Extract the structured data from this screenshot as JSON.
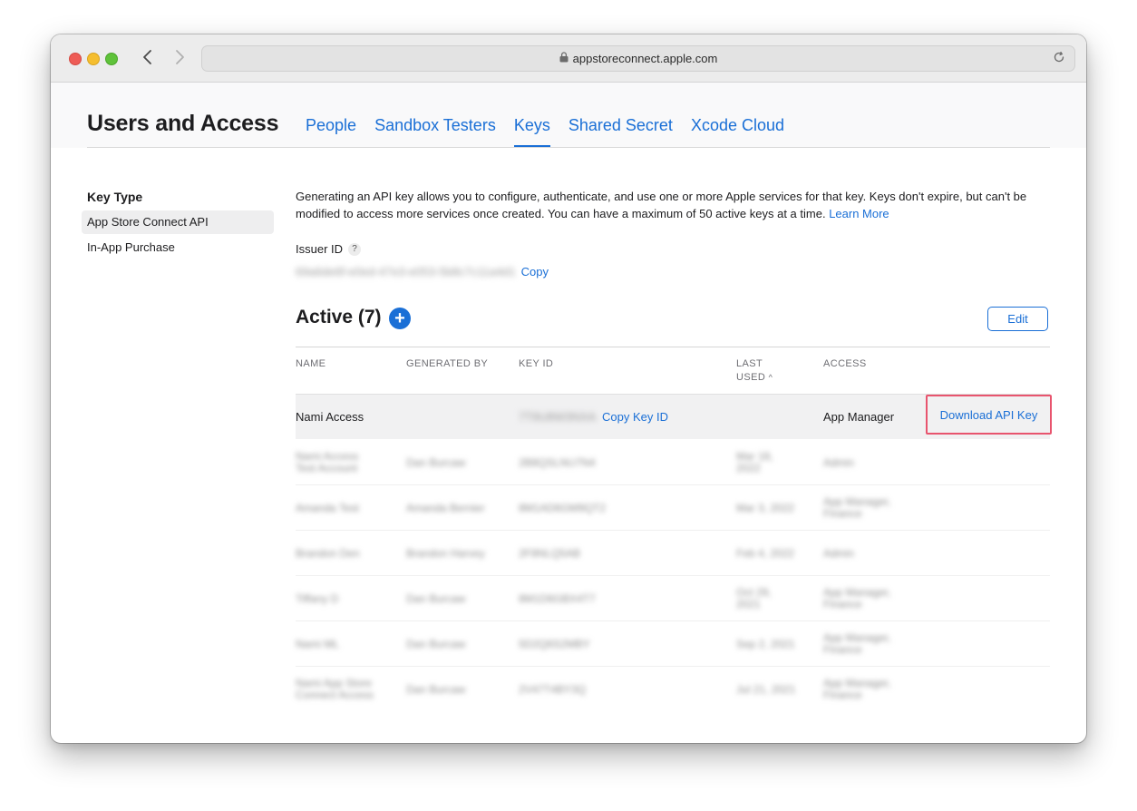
{
  "browser": {
    "url": "appstoreconnect.apple.com"
  },
  "header": {
    "title": "Users and Access",
    "tabs": [
      {
        "label": "People",
        "active": false
      },
      {
        "label": "Sandbox Testers",
        "active": false
      },
      {
        "label": "Keys",
        "active": true
      },
      {
        "label": "Shared Secret",
        "active": false
      },
      {
        "label": "Xcode Cloud",
        "active": false
      }
    ]
  },
  "sidebar": {
    "heading": "Key Type",
    "items": [
      {
        "label": "App Store Connect API",
        "selected": true
      },
      {
        "label": "In-App Purchase",
        "selected": false
      }
    ]
  },
  "main": {
    "description": "Generating an API key allows you to configure, authenticate, and use one or more Apple services for that key. Keys don't expire, but can't be modified to access more services once created. You can have a maximum of 50 active keys at a time.",
    "learn_more": "Learn More",
    "issuer_label": "Issuer ID",
    "issuer_help": "?",
    "issuer_value": "69a6de6f-e0ed-47e3-e053-5b8c7c11a4d1",
    "issuer_copy": "Copy",
    "active_title": "Active (7)",
    "add_symbol": "+",
    "edit_label": "Edit"
  },
  "table": {
    "headers": {
      "name": "NAME",
      "generated_by": "GENERATED BY",
      "key_id": "KEY ID",
      "last": "LAST",
      "used": "USED",
      "sort_indicator": "^",
      "access": "ACCESS"
    },
    "highlight_row": {
      "name": "Nami Access",
      "key_id": "7T9U8W3NXA",
      "copy_key_id": "Copy Key ID",
      "access": "App Manager",
      "download": "Download API Key"
    },
    "rows": [
      {
        "name": [
          "Nami Access",
          "Test Account"
        ],
        "generated_by": "Dan Burcaw",
        "key_id": "2B8QSLNU7N4",
        "last_used": [
          "Mar 18,",
          "2022"
        ],
        "access": [
          "Admin"
        ]
      },
      {
        "name": [
          "Amanda Test"
        ],
        "generated_by": "Amanda Bernier",
        "key_id": "8M1AD6GM9QT2",
        "last_used": [
          "Mar 3, 2022"
        ],
        "access": [
          "App Manager,",
          "Finance"
        ]
      },
      {
        "name": [
          "Brandon Den"
        ],
        "generated_by": "Brandon Harvey",
        "key_id": "2F8NLQ5AB",
        "last_used": [
          "Feb 4, 2022"
        ],
        "access": [
          "Admin"
        ]
      },
      {
        "name": [
          "Tiffany D"
        ],
        "generated_by": "Dan Burcaw",
        "key_id": "8M1D6GBX4T7",
        "last_used": [
          "Oct 29,",
          "2021"
        ],
        "access": [
          "App Manager,",
          "Finance"
        ]
      },
      {
        "name": [
          "Nami ML"
        ],
        "generated_by": "Dan Burcaw",
        "key_id": "5D2Q6S2MBY",
        "last_used": [
          "Sep 2, 2021"
        ],
        "access": [
          "App Manager,",
          "Finance"
        ]
      },
      {
        "name": [
          "Nami App Store",
          "Connect Access"
        ],
        "generated_by": "Dan Burcaw",
        "key_id": "2V47T4BY3Q",
        "last_used": [
          "Jul 21, 2021"
        ],
        "access": [
          "App Manager,",
          "Finance"
        ]
      }
    ]
  }
}
